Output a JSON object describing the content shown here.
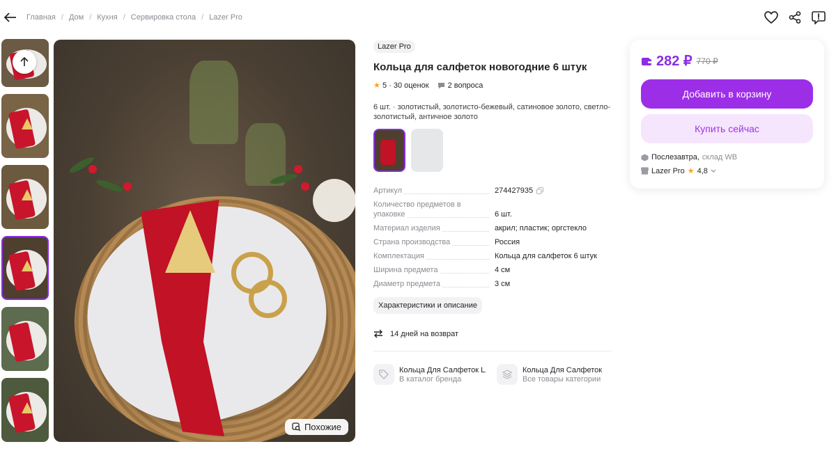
{
  "breadcrumbs": [
    "Главная",
    "Дом",
    "Кухня",
    "Сервировка стола",
    "Lazer Pro"
  ],
  "brand": "Lazer Pro",
  "title": "Кольца для салфеток новогодние 6 штук",
  "rating": "5",
  "reviews": "30 оценок",
  "questions": "2 вопроса",
  "colors_text": "6 шт. · золотистый, золотисто-бежевый, сатиновое золото, светло-золотистый, античное золото",
  "specs": [
    {
      "k": "Артикул",
      "v": "274427935"
    },
    {
      "k": "Количество предметов в упаковке",
      "v": "6 шт."
    },
    {
      "k": "Материал изделия",
      "v": "акрил; пластик; оргстекло"
    },
    {
      "k": "Страна производства",
      "v": "Россия"
    },
    {
      "k": "Комплектация",
      "v": "Кольца для салфеток 6 штук"
    },
    {
      "k": "Ширина предмета",
      "v": "4 см"
    },
    {
      "k": "Диаметр предмета",
      "v": "3 см"
    }
  ],
  "desc_button": "Характеристики и описание",
  "returns": "14 дней на возврат",
  "links": [
    {
      "title": "Кольца Для Салфеток LA",
      "sub": "В каталог бренда"
    },
    {
      "title": "Кольца Для Салфеток",
      "sub": "Все товары категории"
    }
  ],
  "similar_label": "Похожие",
  "price": "282 ₽",
  "old_price": "770 ₽",
  "cart_button": "Добавить в корзину",
  "buy_button": "Купить сейчас",
  "delivery_main": "Послезавтра,",
  "delivery_sub": "склад WB",
  "seller_name": "Lazer Pro",
  "seller_rating": "4,8",
  "colors": {
    "accent": "#8b2de4",
    "accent_light": "#f6e6fd",
    "star": "#ff9f1a"
  }
}
